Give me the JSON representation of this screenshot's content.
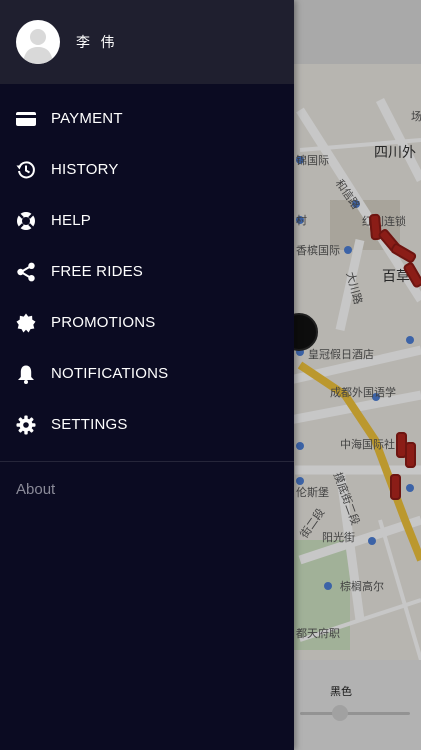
{
  "profile": {
    "name": "李 伟",
    "avatar_icon": "person-silhouette-icon"
  },
  "menu": [
    {
      "label": "PAYMENT",
      "icon": "credit-card-icon"
    },
    {
      "label": "HISTORY",
      "icon": "history-clock-icon"
    },
    {
      "label": "HELP",
      "icon": "lifebuoy-icon"
    },
    {
      "label": "FREE RIDES",
      "icon": "share-icon"
    },
    {
      "label": "PROMOTIONS",
      "icon": "promo-badge-icon"
    },
    {
      "label": "NOTIFICATIONS",
      "icon": "bell-icon"
    },
    {
      "label": "SETTINGS",
      "icon": "gear-icon"
    }
  ],
  "about_label": "About",
  "map": {
    "labels": [
      "四川外",
      "锦国际",
      "红利连锁",
      "香槟国际",
      "百草",
      "和信路",
      "大川路",
      "村",
      "皇冠假日酒店",
      "成都外国语学",
      "中海国际社",
      "伦斯堡",
      "摸底街二段",
      "街二段",
      "阳光街",
      "棕榈高尔",
      "都天府职",
      "场"
    ],
    "bottom_label": "黑色"
  },
  "colors": {
    "drawer_bg": "#0b0b22",
    "profile_bg": "#1f1f2f",
    "text_primary": "#ffffff",
    "text_muted": "#8a8a98",
    "car_red": "#b3261e"
  }
}
